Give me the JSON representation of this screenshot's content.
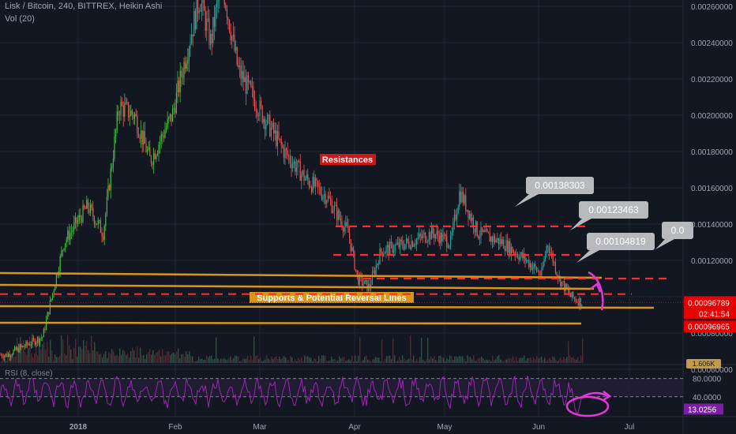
{
  "header": {
    "symbol_line": "Lisk / Bitcoin, 240, BITTREX, Heikin Ashi",
    "volume_label": "Vol (20)",
    "volume_value": "1.606K",
    "rsi_label": "RSI (8, close)"
  },
  "colors": {
    "background": "#131722",
    "grid": "#1f2433",
    "candle_up": "#26a69a",
    "candle_up_bright": "#3fbf3f",
    "candle_down": "#ef5350",
    "resistance": "#ff2a2a",
    "support": "#d9951a",
    "annotation_label_bg": "#b7b9bd",
    "magenta": "#e03ad8",
    "rsi_line": "#9c27b0",
    "current_price_bg": "#e60000"
  },
  "chart_data": {
    "type": "candlestick",
    "title": "Lisk / Bitcoin, 240, BITTREX, Heikin Ashi",
    "x_tick_labels": [
      "2018",
      "Feb",
      "Mar",
      "Apr",
      "May",
      "Jun",
      "Jul"
    ],
    "y_tick_labels": [
      "0.00260000",
      "0.00240000",
      "0.00220000",
      "0.00200000",
      "0.00180000",
      "0.00160000",
      "0.00140000",
      "0.00120000",
      "0.00080000",
      "0.00060000"
    ],
    "ylim": [
      0.00052,
      0.0027
    ],
    "price_path": [
      {
        "x": "Dec 12",
        "y": 0.00068
      },
      {
        "x": "Dec 22",
        "y": 0.00078
      },
      {
        "x": "Dec 28",
        "y": 0.0013
      },
      {
        "x": "Jan 4",
        "y": 0.0015
      },
      {
        "x": "Jan 9",
        "y": 0.00135
      },
      {
        "x": "Jan 14",
        "y": 0.00205
      },
      {
        "x": "Jan 19",
        "y": 0.002
      },
      {
        "x": "Jan 24",
        "y": 0.00175
      },
      {
        "x": "Jan 31",
        "y": 0.002
      },
      {
        "x": "Feb 6",
        "y": 0.0024
      },
      {
        "x": "Feb 10",
        "y": 0.00265
      },
      {
        "x": "Feb 14",
        "y": 0.0024
      },
      {
        "x": "Feb 18",
        "y": 0.00275
      },
      {
        "x": "Feb 24",
        "y": 0.00225
      },
      {
        "x": "Mar 2",
        "y": 0.002
      },
      {
        "x": "Mar 9",
        "y": 0.0018
      },
      {
        "x": "Mar 16",
        "y": 0.00165
      },
      {
        "x": "Mar 23",
        "y": 0.00155
      },
      {
        "x": "Mar 30",
        "y": 0.00135
      },
      {
        "x": "Apr 2",
        "y": 0.0011
      },
      {
        "x": "Apr 6",
        "y": 0.00105
      },
      {
        "x": "Apr 10",
        "y": 0.00125
      },
      {
        "x": "Apr 20",
        "y": 0.0013
      },
      {
        "x": "Apr 28",
        "y": 0.00135
      },
      {
        "x": "May 3",
        "y": 0.0013
      },
      {
        "x": "May 6",
        "y": 0.00158
      },
      {
        "x": "May 12",
        "y": 0.00135
      },
      {
        "x": "May 20",
        "y": 0.0013
      },
      {
        "x": "May 28",
        "y": 0.0012
      },
      {
        "x": "Jun 2",
        "y": 0.00112
      },
      {
        "x": "Jun 4",
        "y": 0.0013
      },
      {
        "x": "Jun 8",
        "y": 0.0011
      },
      {
        "x": "Jun 12",
        "y": 0.001
      },
      {
        "x": "Jun 16",
        "y": 0.000968
      }
    ],
    "resistance_levels": [
      0.00138303,
      0.00123463,
      0.00104819
    ],
    "price_labels": [
      "0.00138303",
      "0.00123463",
      "0.00104819",
      "0.0"
    ],
    "resistance_label": "Resistances",
    "support_label": "Supports & Potential Reversal Lines",
    "support_levels": [
      {
        "y_start": 0.00095,
        "y_end": 0.00094
      },
      {
        "y_start": 0.00089,
        "y_end": 0.00087
      },
      {
        "y_start": 0.00083,
        "y_end": 0.00083
      },
      {
        "y_start": 0.00072,
        "y_end": 0.00072
      }
    ],
    "upper_dashed_level": 0.00101,
    "current_price": "0.00096789",
    "countdown": "02:41:54",
    "second_price": "0.00096965",
    "rsi": {
      "value": "13.0256",
      "levels": [
        "80.0000",
        "40.0000"
      ],
      "ylim": [
        0,
        100
      ],
      "overbought": 80,
      "oversold": 40
    }
  }
}
